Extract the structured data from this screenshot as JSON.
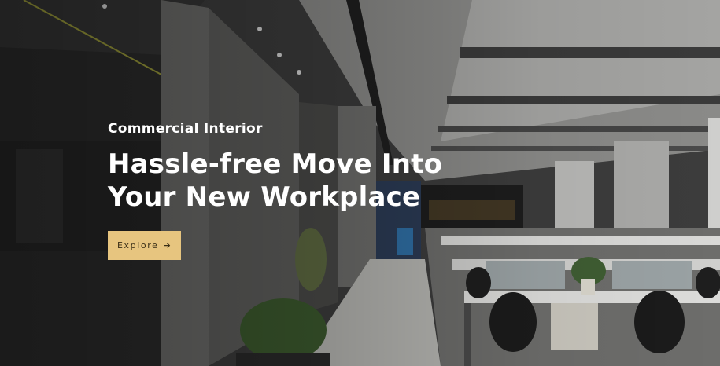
{
  "hero": {
    "eyebrow": "Commercial Interior",
    "headline_line1": "Hassle-free Move Into",
    "headline_line2": "Your New Workplace",
    "cta_label": "Explore",
    "cta_icon": "arrow-right-icon",
    "cta_color": "#e7c57f"
  }
}
